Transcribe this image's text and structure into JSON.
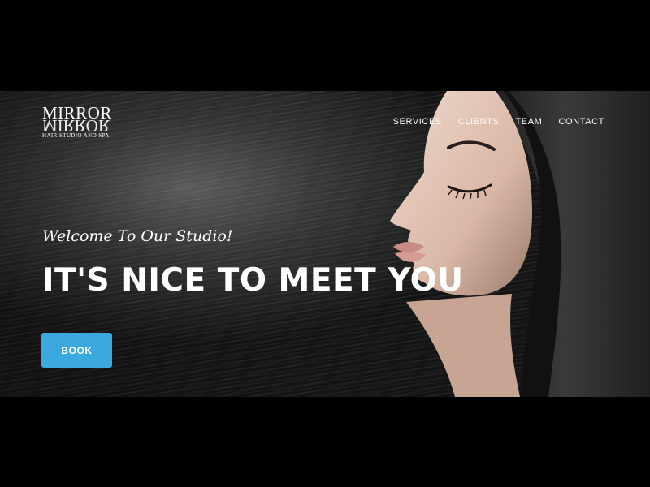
{
  "brand": {
    "name": "MIRROR",
    "subtitle": "HAIR STUDIO AND SPA"
  },
  "nav": {
    "items": [
      {
        "label": "SERVICES"
      },
      {
        "label": "CLIENTS"
      },
      {
        "label": "TEAM"
      },
      {
        "label": "CONTACT"
      }
    ]
  },
  "hero": {
    "tagline": "Welcome To Our Studio!",
    "headline": "IT'S NICE TO MEET YOU",
    "cta_label": "BOOK"
  },
  "colors": {
    "background": "#000000",
    "cta": "#3aa9e0",
    "text": "#ffffff"
  },
  "icons": {
    "hero_image": "woman-with-long-hair-image"
  }
}
